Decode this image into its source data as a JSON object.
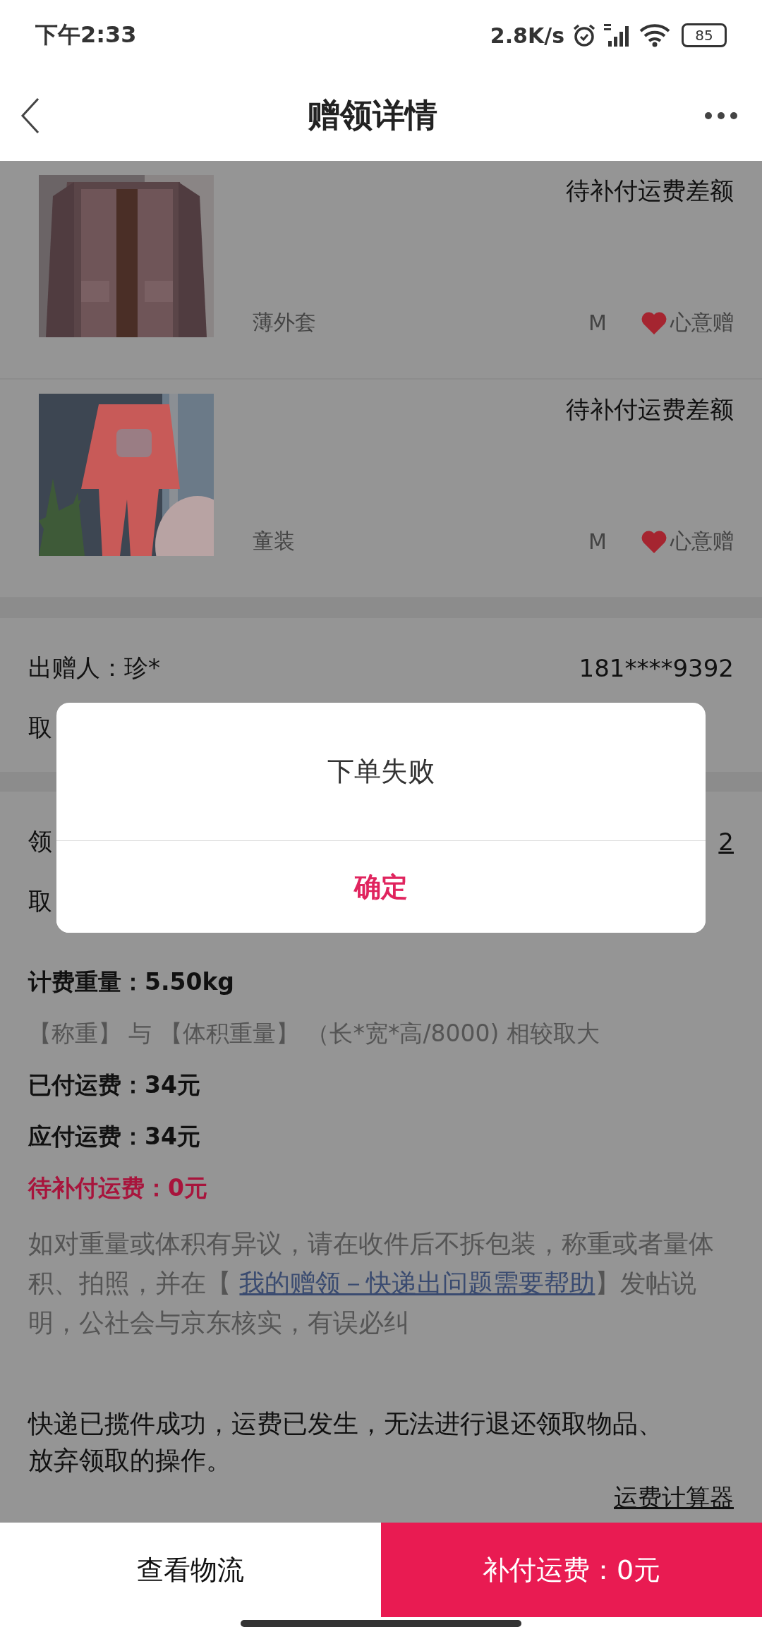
{
  "status_bar": {
    "time": "下午2:33",
    "net_speed": "2.8K/s",
    "battery": "85"
  },
  "header": {
    "title": "赠领详情"
  },
  "items": [
    {
      "status": "待补付运费差额",
      "name": "薄外套",
      "size": "M",
      "tag": "心意赠"
    },
    {
      "status": "待补付运费差额",
      "name": "童装",
      "size": "M",
      "tag": "心意赠"
    }
  ],
  "sender": {
    "label": "出赠人：珍*",
    "phone": "181****9392",
    "row_2": "取"
  },
  "receiver": {
    "row_1": "领",
    "row_1_value": "2",
    "row_2": "取"
  },
  "fees": {
    "weight": "计费重量：5.50kg",
    "formula": "【称重】 与 【体积重量】 （长*宽*高/8000) 相较取大",
    "paid": "已付运费：34元",
    "due": "应付运费：34元",
    "pending": "待补付运费：0元",
    "note_before": "如对重量或体积有异议，请在收件后不拆包装，称重或者量体积、拍照，并在【 ",
    "note_link": "我的赠领－快递出问题需要帮助",
    "note_after": "】发帖说明，公社会与京东核实，有误必纠"
  },
  "notice": "快递已揽件成功，运费已发生，无法进行退还领取物品、放弃领取的操作。",
  "calculator_link": "运费计算器",
  "dialog": {
    "message": "下单失败",
    "confirm": "确定"
  },
  "actions": [
    {
      "label": "查看物流",
      "kind": "plain"
    },
    {
      "label": "补付运费：0元",
      "kind": "primary"
    }
  ]
}
